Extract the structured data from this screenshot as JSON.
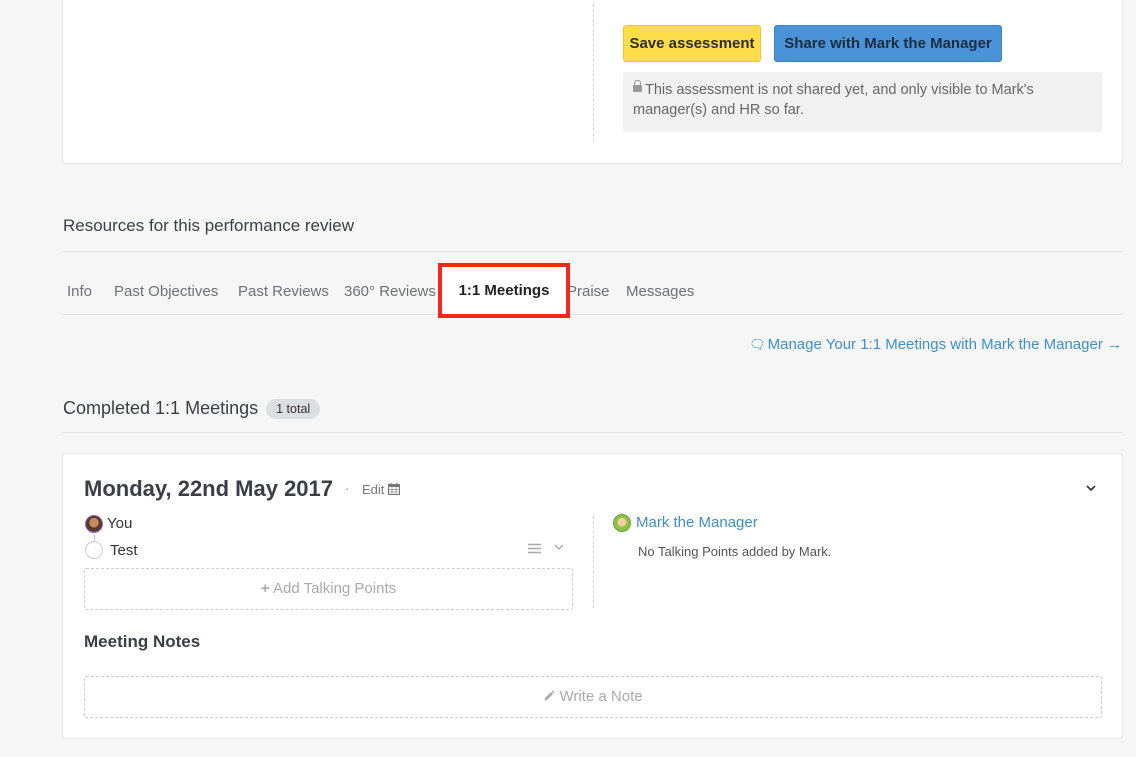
{
  "assessment": {
    "save_label": "Save assessment",
    "share_label": "Share with Mark the Manager",
    "notice": "This assessment is not shared yet, and only visible to Mark's manager(s) and HR so far."
  },
  "resources": {
    "title": "Resources for this performance review",
    "tabs": [
      "Info",
      "Past Objectives",
      "Past Reviews",
      "360° Reviews",
      "1:1 Meetings",
      "Praise",
      "Messages"
    ],
    "active_tab": "1:1 Meetings",
    "manage_link": "Manage Your 1:1 Meetings with Mark the Manager →"
  },
  "completed": {
    "title": "Completed 1:1 Meetings",
    "badge": "1 total"
  },
  "meeting": {
    "date": "Monday, 22nd May 2017",
    "separator": "·",
    "edit_label": "Edit",
    "you_label": "You",
    "talking_points": [
      "Test"
    ],
    "add_talking_points": "Add Talking Points",
    "manager_name": "Mark the Manager",
    "manager_no_points": "No Talking Points added by Mark.",
    "notes_title": "Meeting Notes",
    "write_note": "Write a Note"
  },
  "icons": {
    "lock": "lock-icon",
    "chat": "chat-icon",
    "calendar": "calendar-icon",
    "plus": "plus-icon",
    "pencil": "pencil-icon",
    "menu": "menu-icon",
    "chevron": "chevron-down-icon"
  },
  "colors": {
    "save_button": "#ffdc4a",
    "share_button": "#4a93d6",
    "highlight_border": "#f5261a",
    "link": "#3d8fd1"
  }
}
